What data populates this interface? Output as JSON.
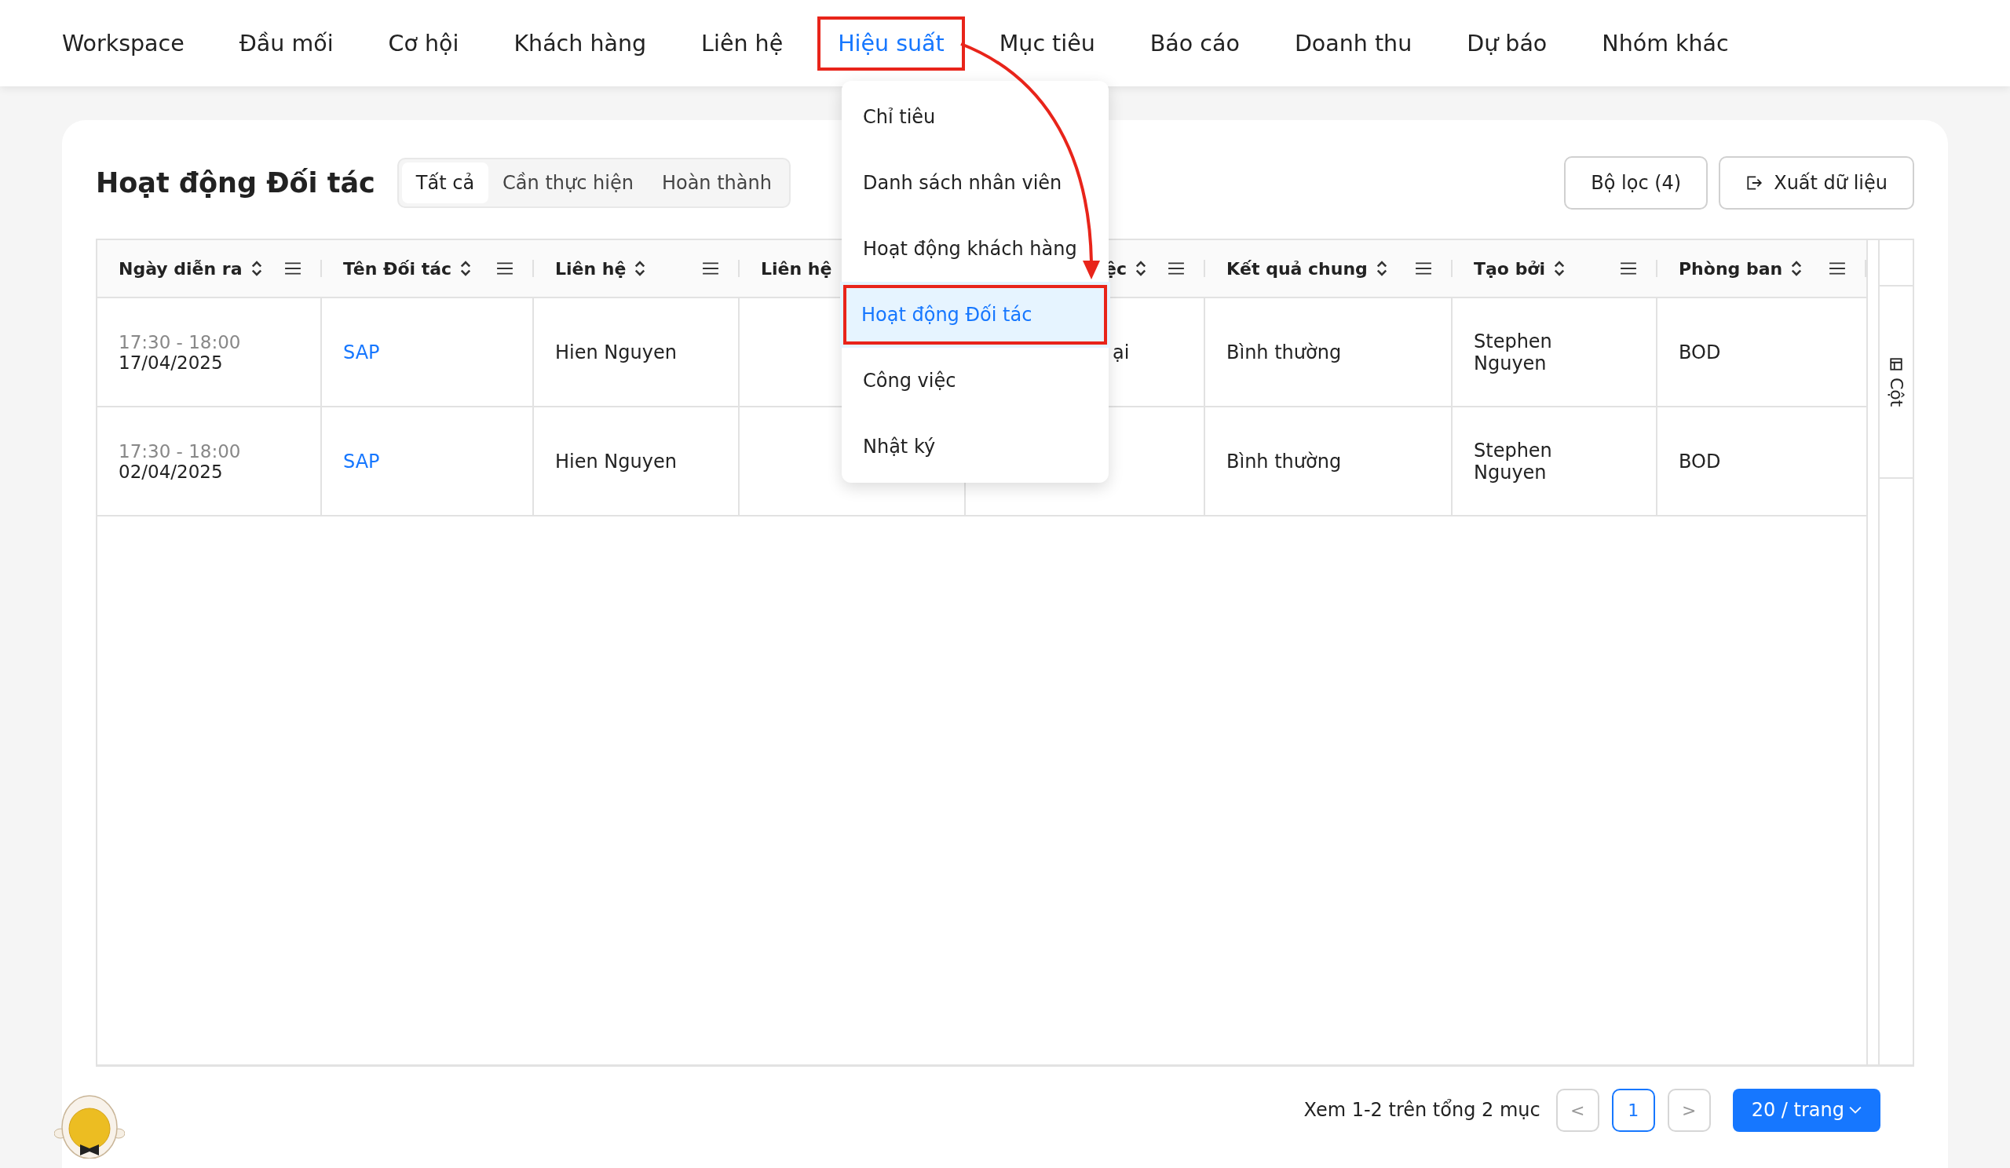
{
  "nav": {
    "items": [
      {
        "label": "Workspace",
        "selected": false
      },
      {
        "label": "Đầu mối",
        "selected": false
      },
      {
        "label": "Cơ hội",
        "selected": false
      },
      {
        "label": "Khách hàng",
        "selected": false
      },
      {
        "label": "Liên hệ",
        "selected": false
      },
      {
        "label": "Hiệu suất",
        "selected": true
      },
      {
        "label": "Mục tiêu",
        "selected": false
      },
      {
        "label": "Báo cáo",
        "selected": false
      },
      {
        "label": "Doanh thu",
        "selected": false
      },
      {
        "label": "Dự báo",
        "selected": false
      },
      {
        "label": "Nhóm khác",
        "selected": false
      }
    ]
  },
  "menu": {
    "items": [
      {
        "label": "Chỉ tiêu",
        "selected": false
      },
      {
        "label": "Danh sách nhân viên",
        "selected": false
      },
      {
        "label": "Hoạt động khách hàng",
        "selected": false
      },
      {
        "label": "Hoạt động Đối tác",
        "selected": true
      },
      {
        "label": "Công việc",
        "selected": false
      },
      {
        "label": "Nhật ký",
        "selected": false
      }
    ]
  },
  "page": {
    "title": "Hoạt động Đối tác",
    "filters": [
      {
        "label": "Tất cả",
        "selected": true
      },
      {
        "label": "Cần thực hiện",
        "selected": false
      },
      {
        "label": "Hoàn thành",
        "selected": false
      }
    ],
    "filter_button": "Bộ lọc (4)",
    "export_button": "Xuất dữ liệu"
  },
  "table": {
    "columns": [
      {
        "label": "Ngày diễn ra",
        "sortable": true,
        "menu": true
      },
      {
        "label": "Tên Đối tác",
        "sortable": true,
        "menu": true
      },
      {
        "label": "Liên hệ",
        "sortable": true,
        "menu": true
      },
      {
        "label": "Liên hệ"
      },
      {
        "label": "ệc",
        "sortable": true,
        "menu": true
      },
      {
        "label": "Kết quả chung",
        "sortable": true,
        "menu": true
      },
      {
        "label": "Tạo bởi",
        "sortable": true,
        "menu": true
      },
      {
        "label": "Phòng ban",
        "sortable": true,
        "menu": true
      }
    ],
    "rows": [
      {
        "time": "17:30 - 18:00",
        "date": "17/04/2025",
        "partner": "SAP",
        "contact": "Hien Nguyen",
        "column_5": "ại",
        "result": "Bình thường",
        "created_by": "Stephen Nguyen",
        "department": "BOD"
      },
      {
        "time": "17:30 - 18:00",
        "date": "02/04/2025",
        "partner": "SAP",
        "contact": "Hien Nguyen",
        "result": "Bình thường",
        "created_by": "Stephen Nguyen",
        "department": "BOD"
      }
    ],
    "columns_toggle": "Cột"
  },
  "pagination": {
    "summary": "Xem 1-2 trên tổng 2 mục",
    "prev": "<",
    "next": ">",
    "pages": [
      {
        "label": "1",
        "selected": true
      }
    ],
    "page_size": "20 / trang"
  }
}
